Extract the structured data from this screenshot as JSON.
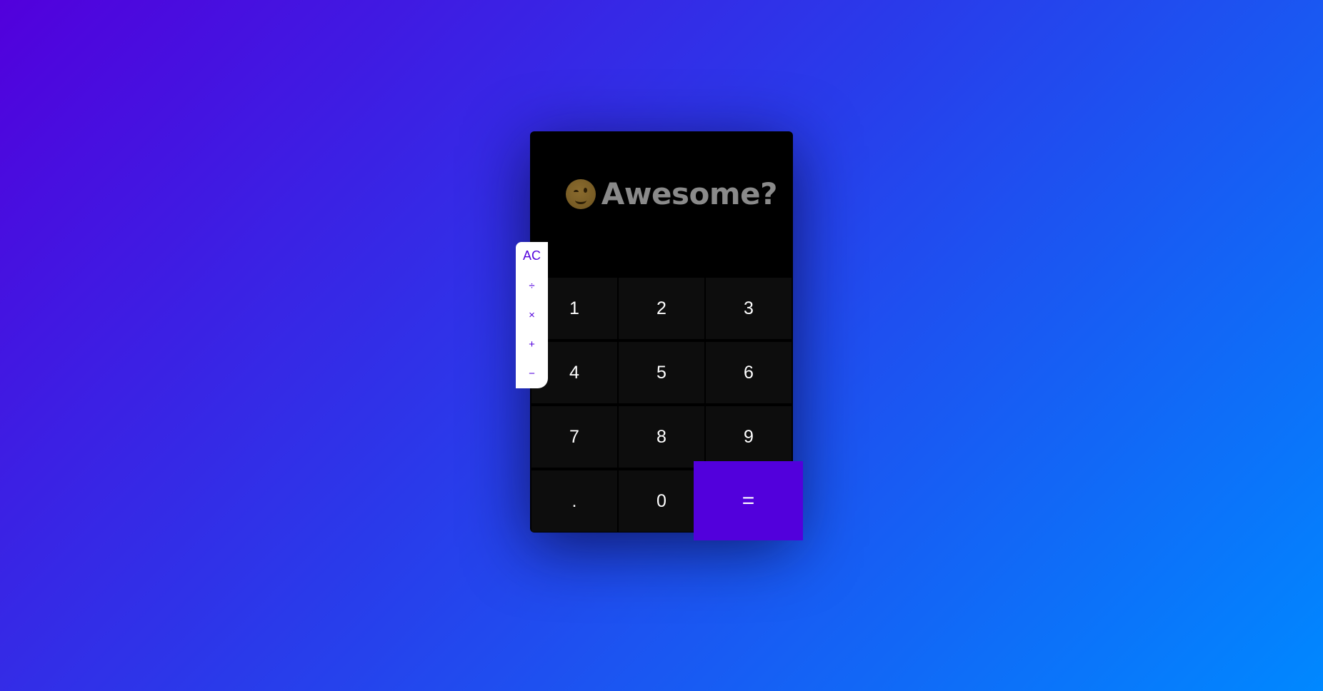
{
  "display": {
    "emoji": "winking-face",
    "text": "Awesome?"
  },
  "operators": [
    {
      "label": "AC",
      "name": "clear"
    },
    {
      "label": "÷",
      "name": "divide"
    },
    {
      "label": "×",
      "name": "multiply"
    },
    {
      "label": "+",
      "name": "add"
    },
    {
      "label": "−",
      "name": "subtract"
    }
  ],
  "keys": [
    {
      "label": "1"
    },
    {
      "label": "2"
    },
    {
      "label": "3"
    },
    {
      "label": "4"
    },
    {
      "label": "5"
    },
    {
      "label": "6"
    },
    {
      "label": "7"
    },
    {
      "label": "8"
    },
    {
      "label": "9"
    },
    {
      "label": "."
    },
    {
      "label": "0"
    }
  ],
  "equals": {
    "label": "="
  },
  "colors": {
    "accent": "#5200dc",
    "key_bg": "#0d0d0d",
    "display_text": "#8a8a8a",
    "background_start": "#5200dc",
    "background_end": "#0088ff"
  }
}
